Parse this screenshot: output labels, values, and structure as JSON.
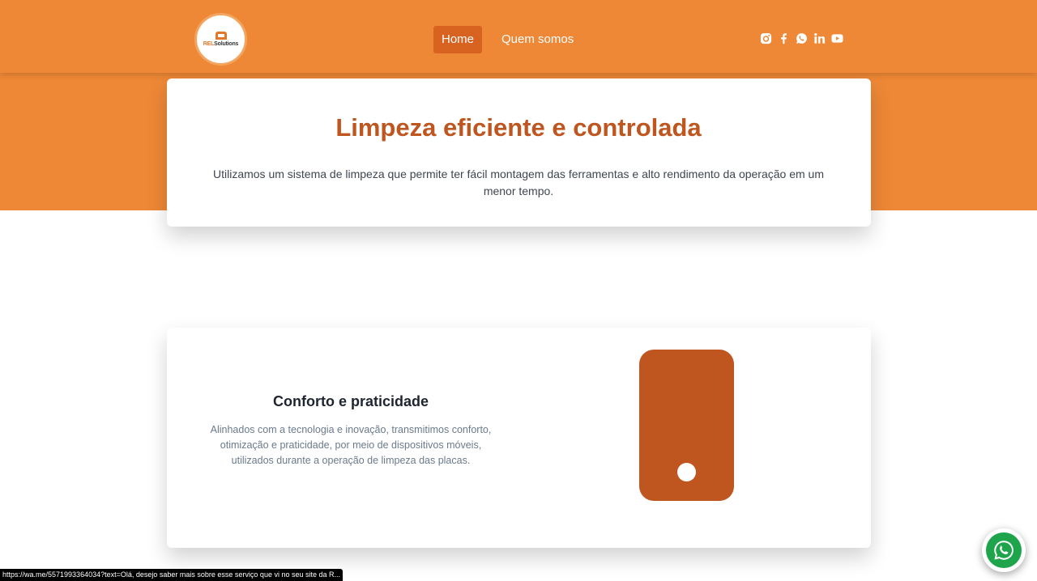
{
  "header": {
    "logo": {
      "brand_prefix": "REL",
      "brand_suffix": "Solutions"
    },
    "nav": [
      {
        "label": "Home",
        "active": true
      },
      {
        "label": "Quem somos",
        "active": false
      }
    ],
    "social_icons": [
      "instagram-icon",
      "facebook-icon",
      "whatsapp-icon",
      "linkedin-icon",
      "youtube-icon"
    ]
  },
  "intro": {
    "title": "Limpeza eficiente e controlada",
    "text": "Utilizamos um sistema de limpeza que permite ter fácil montagem das ferramentas e alto rendimento da operação em um menor tempo."
  },
  "feature": {
    "title": "Conforto e praticidade",
    "text": "Alinhados com a tecnologia e inovação, transmitimos conforto, otimização e praticidade, por meio de dispositivos móveis, utilizados durante a operação de limpeza das placas.",
    "illustration": "mobile-phone-icon"
  },
  "status_bar": {
    "url": "https://wa.me/5571993364034?text=Olá, desejo saber mais sobre esse serviço que vi no seu site da R..."
  },
  "floating_button": {
    "icon": "whatsapp-icon"
  },
  "colors": {
    "orange": "#ee8836",
    "dark_orange": "#c0561f",
    "active_nav": "#d8621f",
    "whatsapp_green": "#1ea44a"
  }
}
